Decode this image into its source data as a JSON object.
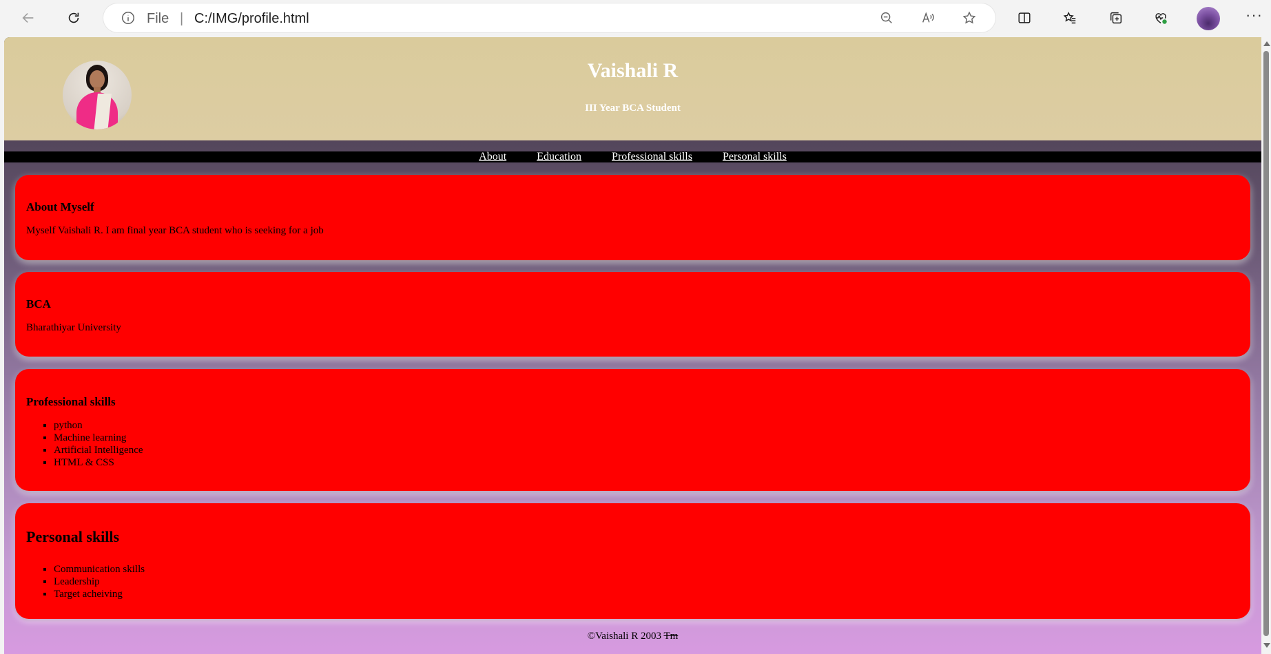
{
  "browser": {
    "scheme": "File",
    "url": "C:/IMG/profile.html",
    "icons": [
      "back-icon",
      "refresh-icon",
      "info-icon",
      "zoom-out-icon",
      "read-aloud-icon",
      "favorite-star-icon",
      "split-screen-icon",
      "favorites-icon",
      "collections-icon",
      "browser-essentials-icon",
      "profile-avatar",
      "more-icon"
    ]
  },
  "header": {
    "name": "Vaishali R",
    "role": "III Year BCA Student"
  },
  "nav": {
    "items": [
      "About",
      "Education",
      "Professional skills",
      "Personal skills"
    ]
  },
  "about": {
    "heading": "About Myself",
    "text": "Myself Vaishali R. I am final year BCA student who is seeking for a job"
  },
  "education": {
    "heading": "BCA",
    "text": "Bharathiyar University"
  },
  "professional": {
    "heading": "Professional skills",
    "items": [
      "python",
      "Machine learning",
      "Artificial Intelligence",
      "HTML & CSS"
    ]
  },
  "personal": {
    "heading": "Personal skills",
    "items": [
      "Communication skills",
      "Leadership",
      "Target acheiving"
    ]
  },
  "footer": {
    "text": "©Vaishali R 2003 ",
    "mark": "Tm"
  },
  "colors": {
    "header_bg": "#dacb9c",
    "card_bg": "#ff0000",
    "nav_bg": "#000000"
  }
}
